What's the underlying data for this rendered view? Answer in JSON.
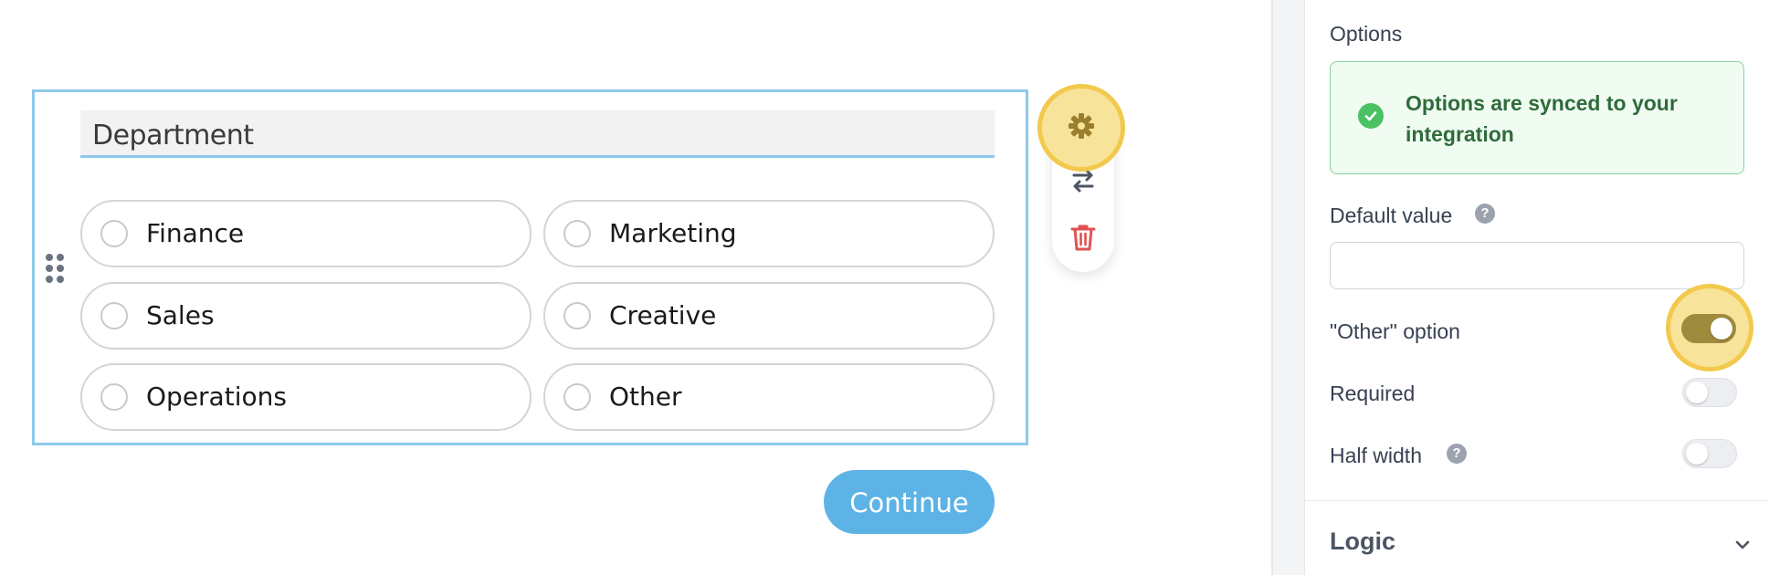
{
  "form": {
    "question_title": "Department",
    "options": [
      "Finance",
      "Marketing",
      "Sales",
      "Creative",
      "Operations",
      "Other"
    ],
    "continue_label": "Continue"
  },
  "toolbar": {
    "icons": [
      "gear-icon",
      "swap-arrows-icon",
      "trash-icon"
    ]
  },
  "panel": {
    "options_heading": "Options",
    "sync_message": "Options are synced to your integration",
    "default_value_label": "Default value",
    "default_value": "",
    "other_option_label": "\"Other\" option",
    "other_option_enabled": true,
    "required_label": "Required",
    "required_enabled": false,
    "half_width_label": "Half width",
    "half_width_enabled": false,
    "logic_heading": "Logic",
    "help_glyph": "?"
  },
  "colors": {
    "selection_border": "#8ec9ea",
    "continue_button": "#5db3e6",
    "highlight": "#f2c94c",
    "success_text": "#2f6b3b",
    "toggle_on": "#a08a3c",
    "delete_red": "#e05252"
  }
}
